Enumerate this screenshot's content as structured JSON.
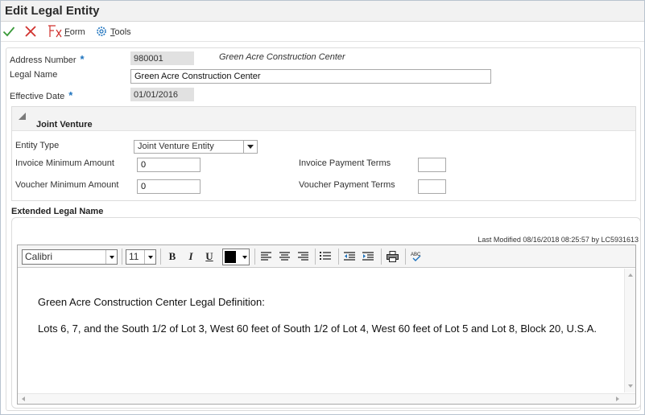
{
  "window": {
    "title": "Edit Legal Entity"
  },
  "toolbar": {
    "form_label": "Form",
    "tools_label": "Tools",
    "icons": [
      "ok-check-icon",
      "cancel-x-icon",
      "form-icon",
      "tools-gear-icon"
    ]
  },
  "header_fields": {
    "address_number_label": "Address Number",
    "address_number_value": "980001",
    "address_number_desc": "Green Acre Construction Center",
    "legal_name_label": "Legal Name",
    "legal_name_value": "Green Acre Construction Center",
    "effective_date_label": "Effective Date",
    "effective_date_value": "01/01/2016",
    "required_marker": "*"
  },
  "joint_venture": {
    "title": "Joint Venture",
    "entity_type_label": "Entity Type",
    "entity_type_value": "Joint Venture Entity",
    "invoice_min_label": "Invoice Minimum Amount",
    "invoice_min_value": "0",
    "voucher_min_label": "Voucher Minimum Amount",
    "voucher_min_value": "0",
    "invoice_terms_label": "Invoice Payment Terms",
    "invoice_terms_value": "",
    "voucher_terms_label": "Voucher Payment Terms",
    "voucher_terms_value": ""
  },
  "extended": {
    "title": "Extended Legal Name",
    "last_modified": "Last Modified 08/16/2018 08:25:57 by LC5931613",
    "editor": {
      "font": "Calibri",
      "size": "11",
      "text_color": "#000000",
      "paragraph1": "Green Acre Construction Center Legal Definition:",
      "paragraph2": "Lots 6, 7, and the South 1/2 of Lot 3, West 60 feet of South 1/2 of Lot 4, West 60 feet of Lot 5 and Lot 8, Block 20, U.S.A."
    }
  },
  "colors": {
    "accent": "#1e73be",
    "ok_green": "#3a9a3a",
    "cancel_red": "#d0312d",
    "readonly_bg": "#e1e1e1"
  }
}
